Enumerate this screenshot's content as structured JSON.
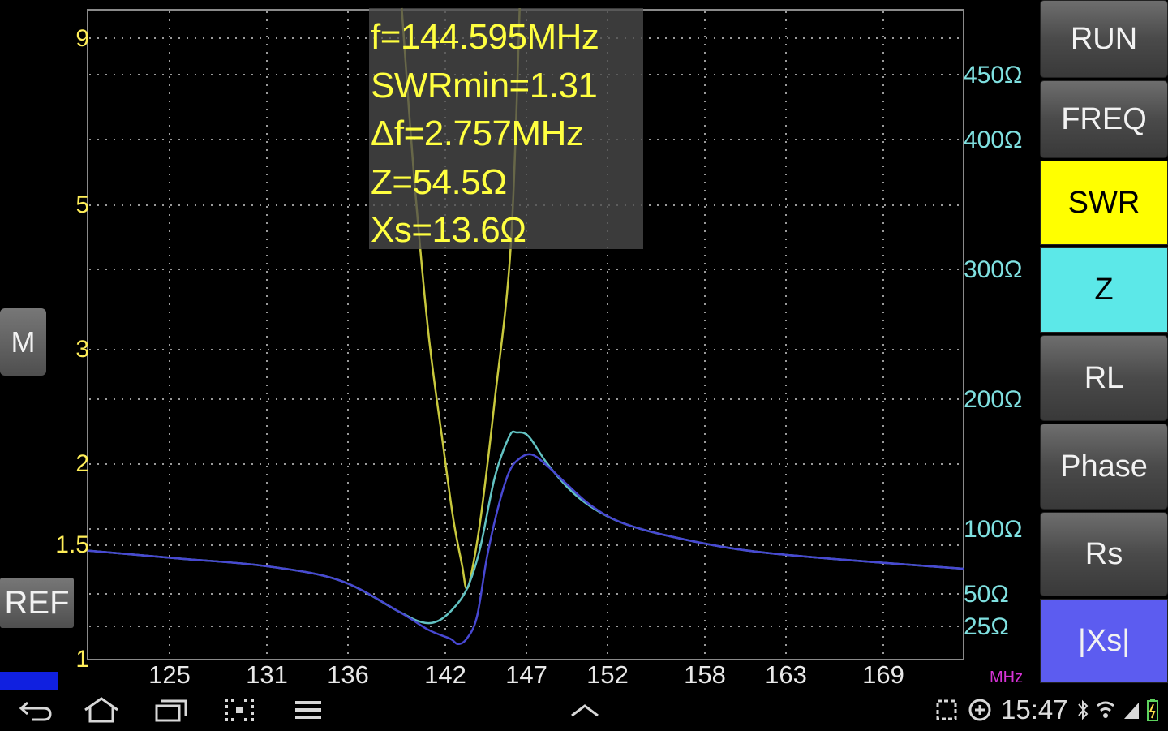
{
  "readout": {
    "freq": "f=144.595MHz",
    "swrmin": "SWRmin=1.31",
    "delta_f": "Δf=2.757MHz",
    "z": "Z=54.5Ω",
    "xs": "Xs=13.6Ω"
  },
  "chart_data": {
    "type": "line",
    "x_unit": "MHz",
    "xlim": [
      118.9,
      178.3
    ],
    "x_ticks": [
      "125",
      "131",
      "136",
      "142",
      "147",
      "152",
      "158",
      "163",
      "169"
    ],
    "y_left_ticks": [
      "9",
      "5",
      "3",
      "2",
      "1.5",
      "1"
    ],
    "y_right_ticks": [
      "450Ω",
      "400Ω",
      "300Ω",
      "200Ω",
      "100Ω",
      "50Ω",
      "25Ω"
    ],
    "grid": true,
    "series": [
      {
        "name": "SWR",
        "axis": "left",
        "color": "#c8c83c",
        "x": [
          140.2,
          141.0,
          142.0,
          143.0,
          143.7,
          144.3,
          144.6,
          145.0,
          145.6,
          146.5,
          147.6,
          148.2
        ],
        "y": [
          10.0,
          5.85,
          3.25,
          2.17,
          1.66,
          1.41,
          1.31,
          1.4,
          1.7,
          2.55,
          4.45,
          10.0
        ]
      },
      {
        "name": "Z",
        "axis": "right",
        "color": "#62c2c2",
        "x": [
          118.9,
          125.0,
          131.0,
          136.0,
          140.0,
          141.5,
          142.5,
          143.5,
          144.6,
          145.5,
          146.5,
          147.5,
          148.0,
          148.8,
          150.0,
          151.5,
          153.0,
          155.0,
          158.0,
          163.0,
          169.0,
          178.3
        ],
        "y": [
          84,
          78,
          72,
          61,
          37,
          29,
          29,
          37,
          54,
          85,
          140,
          172,
          175,
          172,
          152,
          132,
          118,
          106,
          96,
          85,
          78,
          70
        ]
      },
      {
        "name": "|Xs|",
        "axis": "right",
        "color": "#4848d2",
        "x": [
          118.9,
          125.0,
          131.0,
          136.0,
          140.0,
          142.0,
          143.5,
          144.0,
          144.6,
          145.3,
          146.0,
          146.8,
          147.5,
          148.2,
          149.0,
          150.0,
          151.5,
          153.0,
          155.0,
          158.0,
          163.0,
          169.0,
          178.3
        ],
        "y": [
          84,
          78,
          72,
          61,
          37,
          23,
          16,
          12,
          16,
          33,
          80,
          120,
          145,
          155,
          158,
          150,
          134,
          119,
          106,
          96,
          85,
          78,
          70
        ]
      }
    ]
  },
  "buttons": {
    "run": "RUN",
    "freq": "FREQ",
    "swr": "SWR",
    "z": "Z",
    "rl": "RL",
    "phase": "Phase",
    "rs": "Rs",
    "xs": "|Xs|",
    "marker": "M",
    "ref": "REF"
  },
  "colors": {
    "swr_button": "#ffff00",
    "z_button": "#5ce8e8",
    "xs_button": "#5c5cf0",
    "swr_axis": "#ffee58",
    "z_axis": "#7fe0e0"
  },
  "status": {
    "time": "15:47"
  },
  "icons": {
    "nav": [
      "back-icon",
      "home-icon",
      "recent-apps-icon",
      "screenshot-icon",
      "menu-icon",
      "chevron-up-icon"
    ],
    "status": [
      "notification-icon",
      "sync-icon",
      "bluetooth-icon",
      "wifi-icon",
      "signal-icon",
      "battery-icon"
    ]
  }
}
